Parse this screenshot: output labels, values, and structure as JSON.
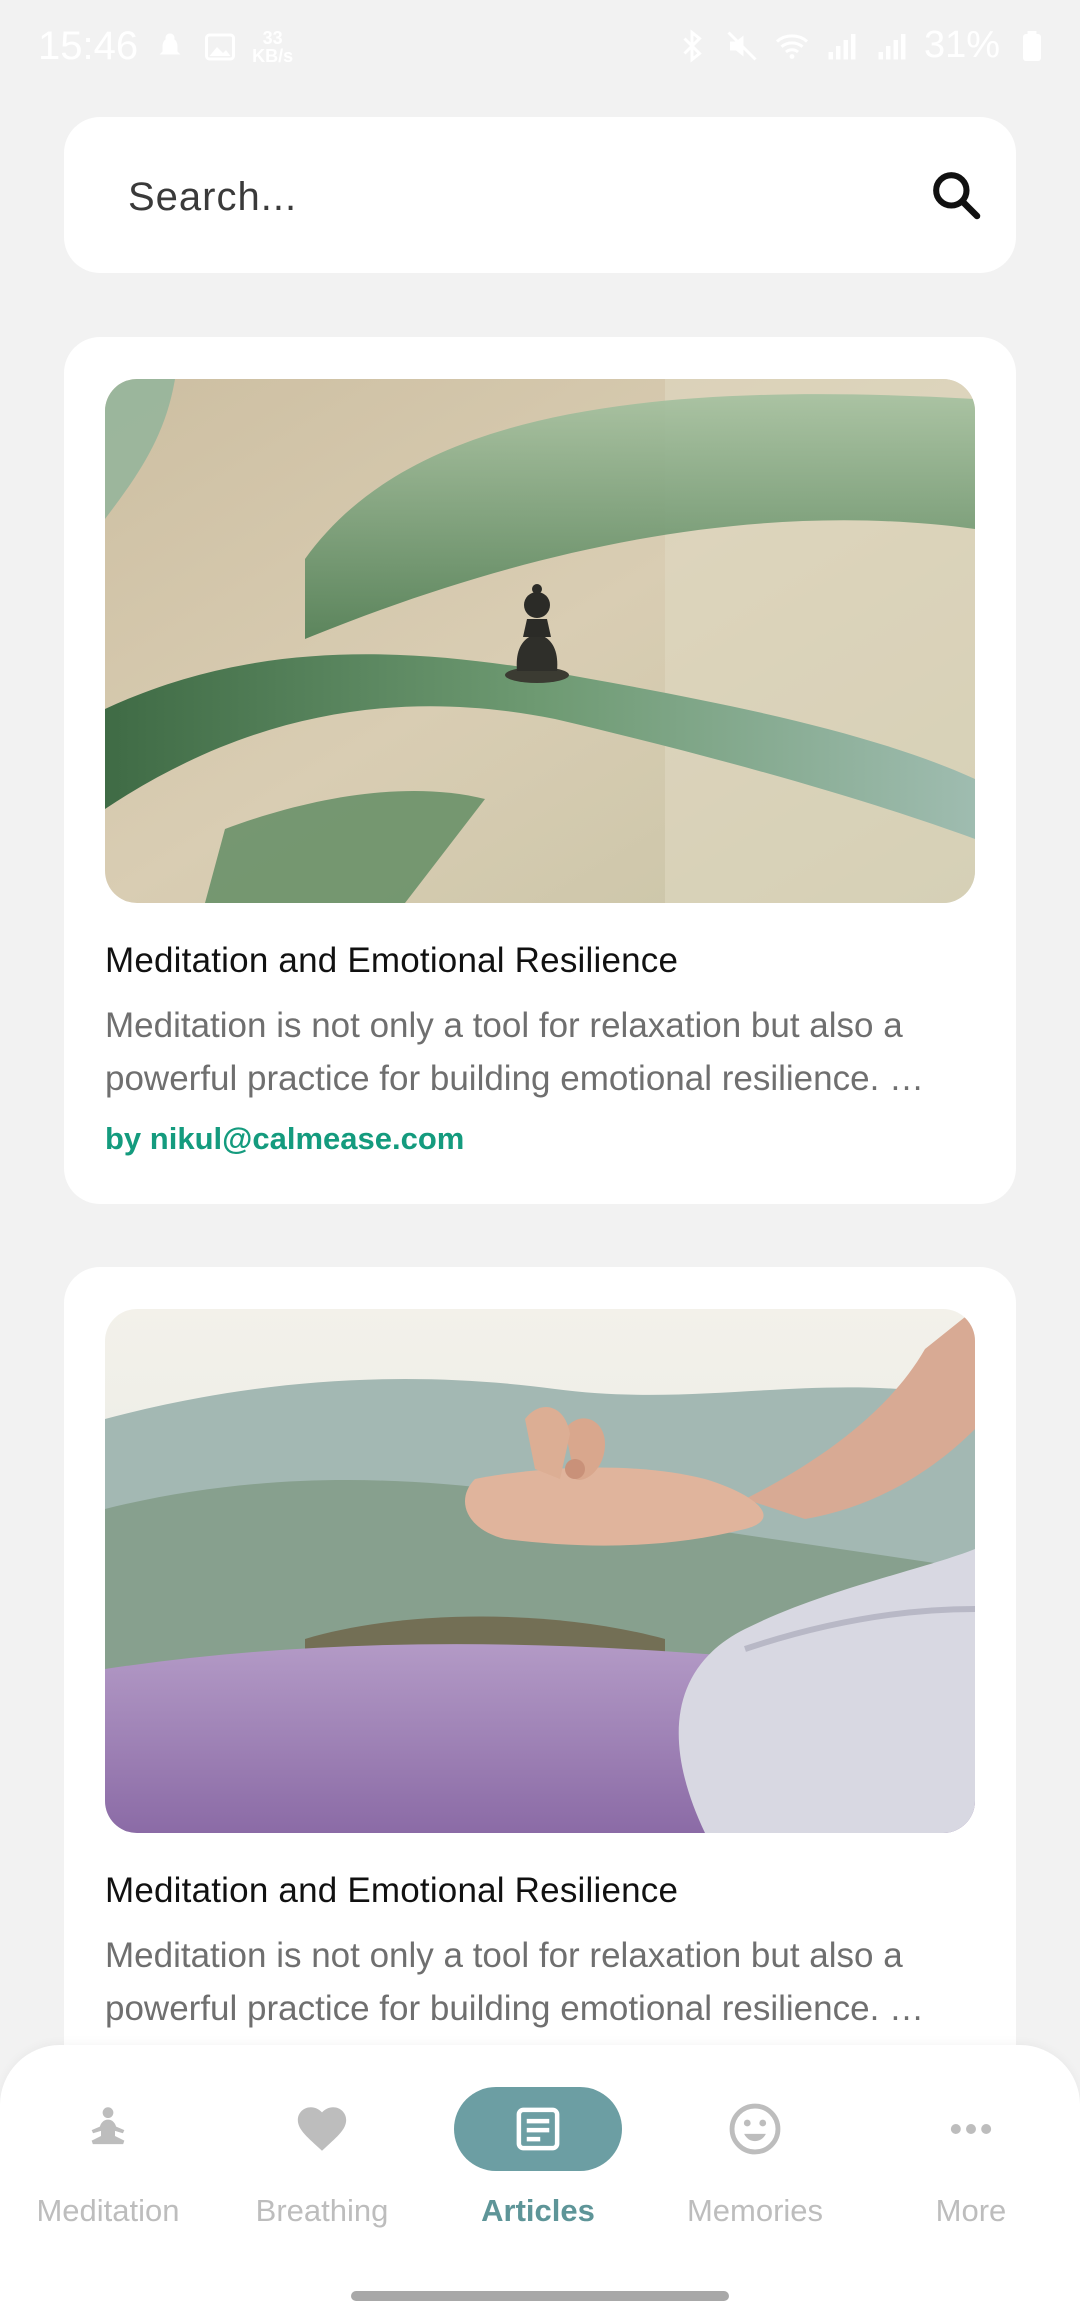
{
  "status_bar": {
    "time": "15:46",
    "net_speed_value": "33",
    "net_speed_unit": "KB/s",
    "battery": "31%"
  },
  "search": {
    "placeholder": "Search..."
  },
  "articles": [
    {
      "title": "Meditation and Emotional Resilience",
      "excerpt": "Meditation is not only a tool for relaxation but also a powerful practice for building emotional resilience. …",
      "author": "by nikul@calmease.com"
    },
    {
      "title": "Meditation and Emotional Resilience",
      "excerpt": "Meditation is not only a tool for relaxation but also a powerful practice for building emotional resilience. …"
    }
  ],
  "bottom_nav": {
    "active": "Articles",
    "items": [
      {
        "label": "Meditation",
        "icon": "meditation-icon"
      },
      {
        "label": "Breathing",
        "icon": "heart-icon"
      },
      {
        "label": "Articles",
        "icon": "article-icon"
      },
      {
        "label": "Memories",
        "icon": "smiley-icon"
      },
      {
        "label": "More",
        "icon": "more-icon"
      }
    ]
  },
  "colors": {
    "accent": "#6c9ea3",
    "author": "#149b7e",
    "background": "#f2f2f2"
  }
}
